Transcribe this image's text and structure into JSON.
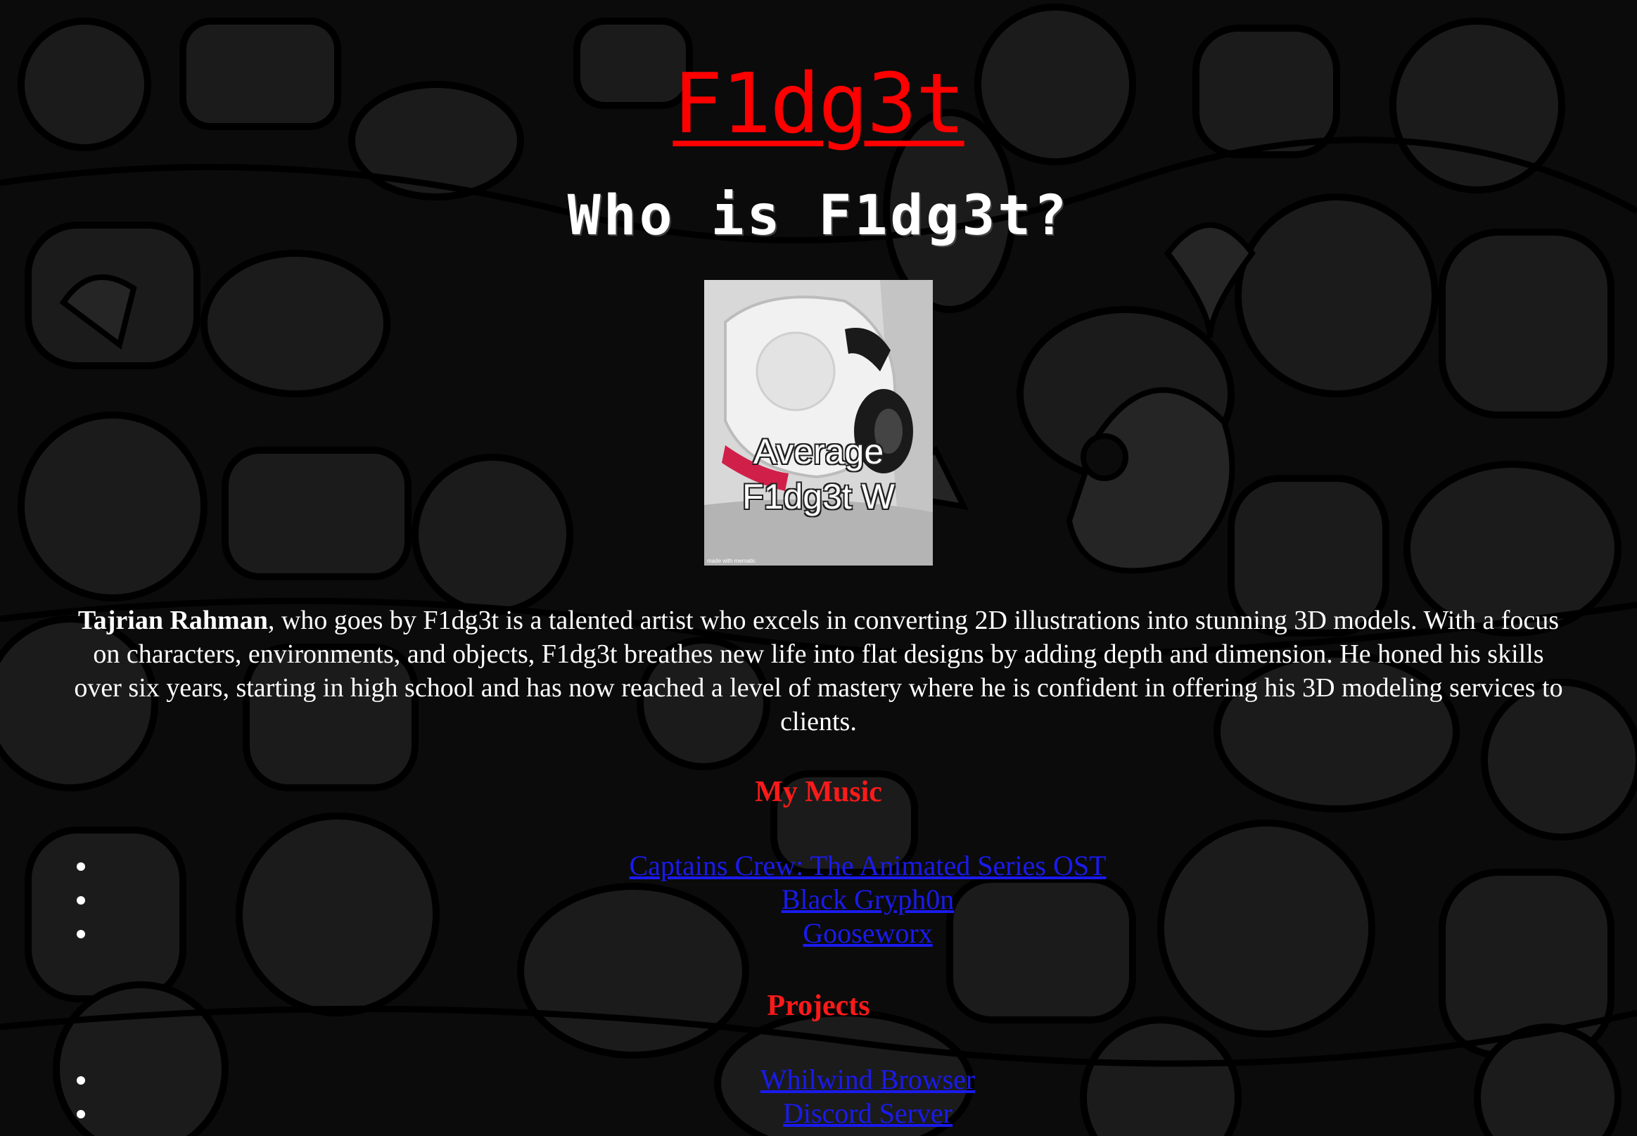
{
  "header": {
    "logo": "F1dg3t",
    "title": "Who is F1dg3t?"
  },
  "profile_image": {
    "caption_line1": "Average",
    "caption_line2": "F1dg3t W",
    "watermark": "made with mematic"
  },
  "bio": {
    "name": "Tajrian Rahman",
    "text": ", who goes by F1dg3t is a talented artist who excels in converting 2D illustrations into stunning 3D models. With a focus on characters, environments, and objects, F1dg3t breathes new life into flat designs by adding depth and dimension. He honed his skills over six years, starting in high school and has now reached a level of mastery where he is confident in offering his 3D modeling services to clients."
  },
  "music": {
    "title": "My Music",
    "items": [
      {
        "label": "Captains Crew: The Animated Series OST"
      },
      {
        "label": "Black Gryph0n"
      },
      {
        "label": "Gooseworx"
      }
    ]
  },
  "projects": {
    "title": "Projects",
    "items": [
      {
        "label": "Whilwind Browser"
      },
      {
        "label": "Discord Server"
      }
    ]
  },
  "colors": {
    "logo": "#ff0000",
    "section_title": "#ff1a1a",
    "link": "#1a1aee",
    "background": "#101010"
  }
}
